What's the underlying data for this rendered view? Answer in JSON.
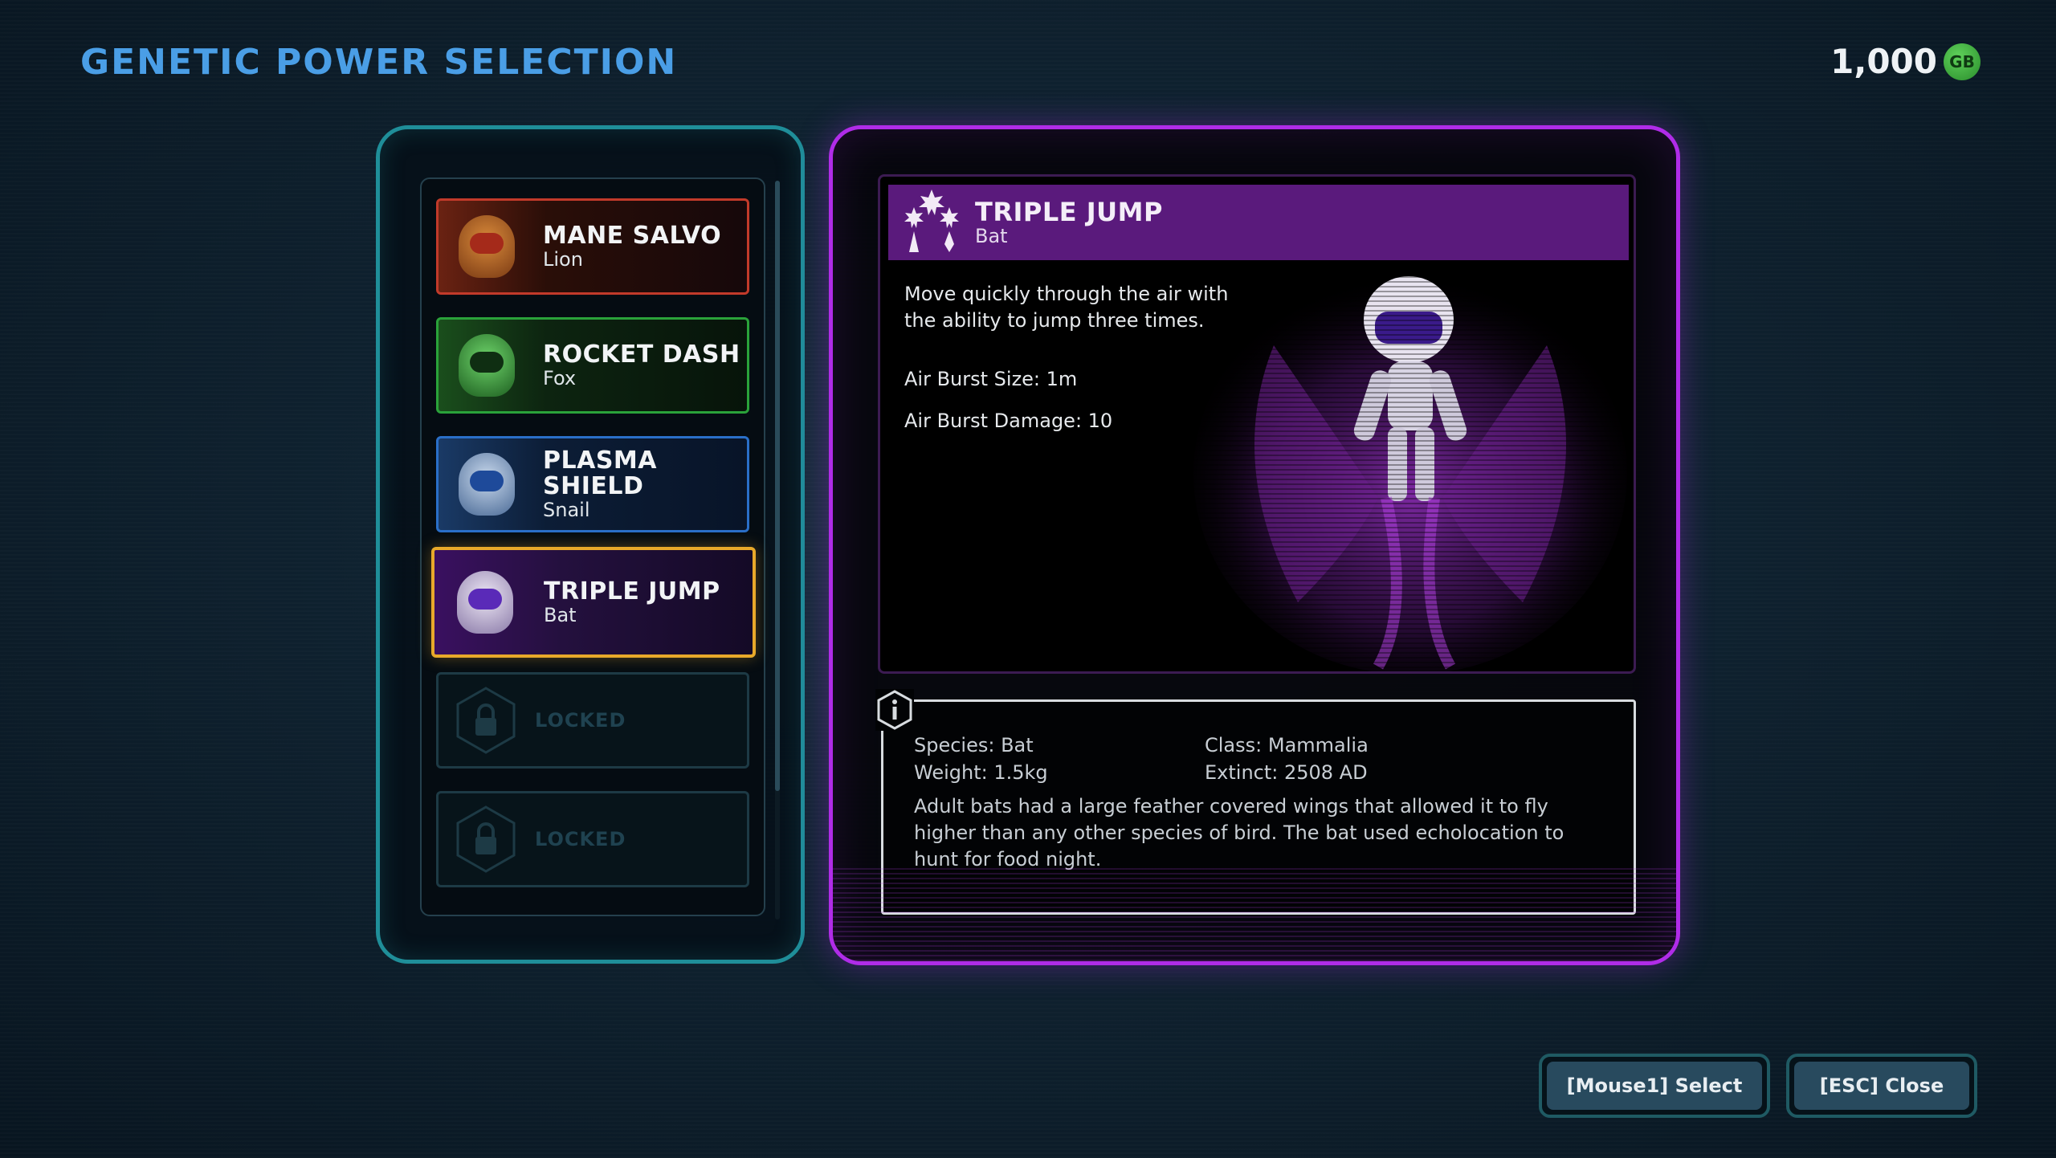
{
  "header": {
    "title": "GENETIC POWER SELECTION",
    "currency_amount": "1,000",
    "currency_icon": "GB"
  },
  "powers": [
    {
      "name": "MANE SALVO",
      "species": "Lion",
      "color": "#c23a2a",
      "icon": "lion-portrait"
    },
    {
      "name": "ROCKET DASH",
      "species": "Fox",
      "color": "#2aa23a",
      "icon": "fox-portrait"
    },
    {
      "name": "PLASMA SHIELD",
      "species": "Snail",
      "color": "#2a6fc8",
      "icon": "snail-portrait"
    },
    {
      "name": "TRIPLE JUMP",
      "species": "Bat",
      "color": "#e8a92a",
      "icon": "bat-portrait",
      "selected": true
    },
    {
      "name": "LOCKED",
      "icon": "lock-icon"
    },
    {
      "name": "LOCKED",
      "icon": "lock-icon"
    }
  ],
  "detail": {
    "name": "TRIPLE JUMP",
    "species": "Bat",
    "description": "Move quickly through the air with the ability to jump three times.",
    "stats": [
      "Air Burst Size: 1m",
      "Air Burst Damage: 10"
    ],
    "accent_color": "#b02ce8"
  },
  "info": {
    "species": "Species: Bat",
    "class": "Class: Mammalia",
    "weight": "Weight: 1.5kg",
    "extinct": "Extinct: 2508 AD",
    "description": "Adult bats had a large feather covered wings that allowed it to fly higher than any other species of bird. The bat used echolocation to hunt for food night."
  },
  "buttons": {
    "select_label": "[Mouse1] Select",
    "close_label": "[ESC] Close"
  }
}
